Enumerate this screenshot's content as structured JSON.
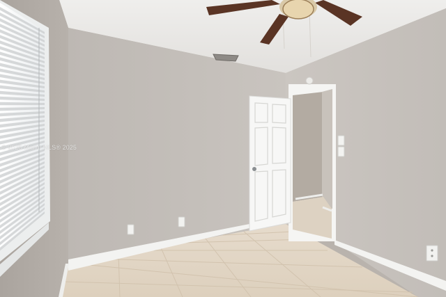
{
  "scene": {
    "description_tags": [
      "empty-bedroom",
      "ceiling-fan",
      "window-blinds",
      "open-door",
      "tile-floor"
    ],
    "colors": {
      "wall": "#c4bfba",
      "ceiling": "#e9e8e5",
      "floor": "#e3d6c5",
      "trim": "#f4f4f2",
      "fan_blade": "#5a3424"
    }
  },
  "watermark": {
    "text": "© 2025 Miami MLS® 2025"
  }
}
